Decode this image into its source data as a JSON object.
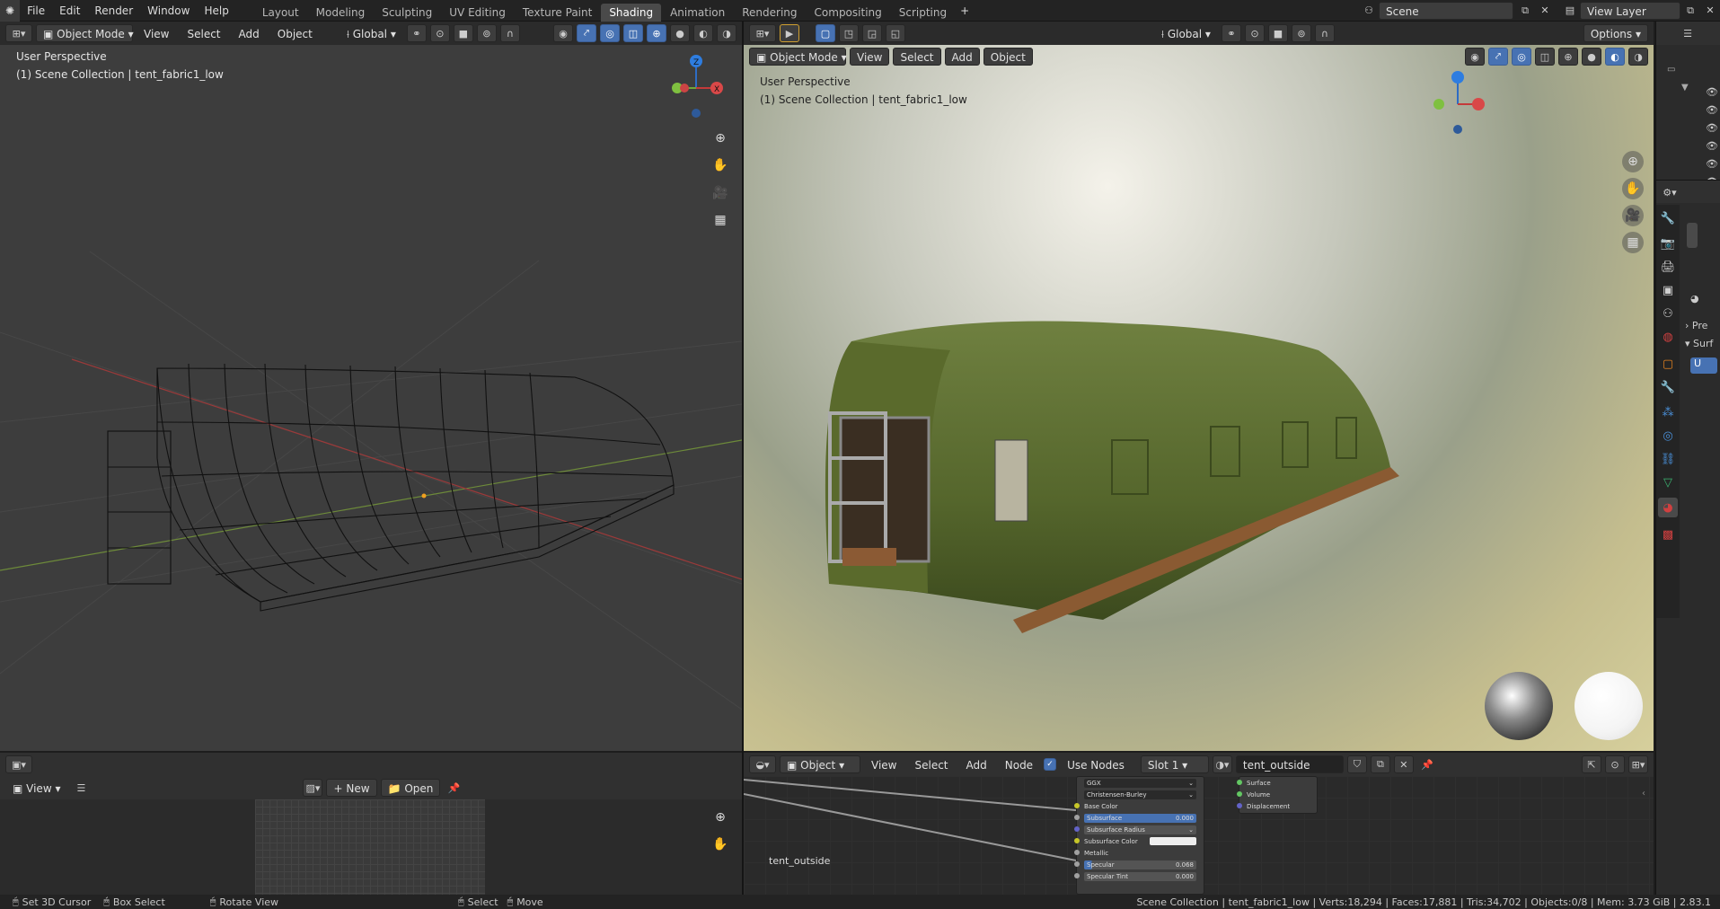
{
  "menu": {
    "file": "File",
    "edit": "Edit",
    "render": "Render",
    "window": "Window",
    "help": "Help"
  },
  "workspaces": [
    "Layout",
    "Modeling",
    "Sculpting",
    "UV Editing",
    "Texture Paint",
    "Shading",
    "Animation",
    "Rendering",
    "Compositing",
    "Scripting"
  ],
  "active_workspace": "Shading",
  "scene": {
    "name": "Scene",
    "view_layer": "View Layer"
  },
  "left_viewport": {
    "mode": "Object Mode",
    "view": "View",
    "select": "Select",
    "add": "Add",
    "object": "Object",
    "orientation": "Global",
    "perspective": "User Perspective",
    "collection": "(1) Scene Collection | tent_fabric1_low"
  },
  "right_viewport": {
    "mode": "Object Mode",
    "view": "View",
    "select": "Select",
    "add": "Add",
    "object": "Object",
    "orientation": "Global",
    "options": "Options",
    "perspective": "User Perspective",
    "collection": "(1) Scene Collection | tent_fabric1_low"
  },
  "image_editor": {
    "view": "View",
    "new": "New",
    "open": "Open"
  },
  "node_editor": {
    "type": "Object",
    "view": "View",
    "select": "Select",
    "add": "Add",
    "node": "Node",
    "use_nodes": "Use Nodes",
    "slot": "Slot 1",
    "material": "tent_outside",
    "label": "tent_outside"
  },
  "bsdf": {
    "distribution": "GGX",
    "subsurface_method": "Christensen-Burley",
    "rows": [
      {
        "label": "Base Color",
        "value": ""
      },
      {
        "label": "Subsurface",
        "value": "0.000"
      },
      {
        "label": "Subsurface Radius",
        "value": ""
      },
      {
        "label": "Subsurface Color",
        "value": ""
      },
      {
        "label": "Metallic",
        "value": ""
      },
      {
        "label": "Specular",
        "value": "0.068"
      },
      {
        "label": "Specular Tint",
        "value": "0.000"
      }
    ]
  },
  "output_node": {
    "surface": "Surface",
    "volume": "Volume",
    "displacement": "Displacement"
  },
  "properties": {
    "preview": "Pre",
    "surface": "Surf",
    "material_slot": "U"
  },
  "status": {
    "cursor": "Set 3D Cursor",
    "box": "Box Select",
    "rotate": "Rotate View",
    "select": "Select",
    "move": "Move",
    "info": "Scene Collection | tent_fabric1_low | Verts:18,294 | Faces:17,881 | Tris:34,702 | Objects:0/8 | Mem: 3.73 GiB | 2.83.1"
  },
  "colors": {
    "accent": "#4772b3",
    "active_tab": "#4a4a4a",
    "header": "#303030",
    "tent_green": "#5d6e34"
  }
}
